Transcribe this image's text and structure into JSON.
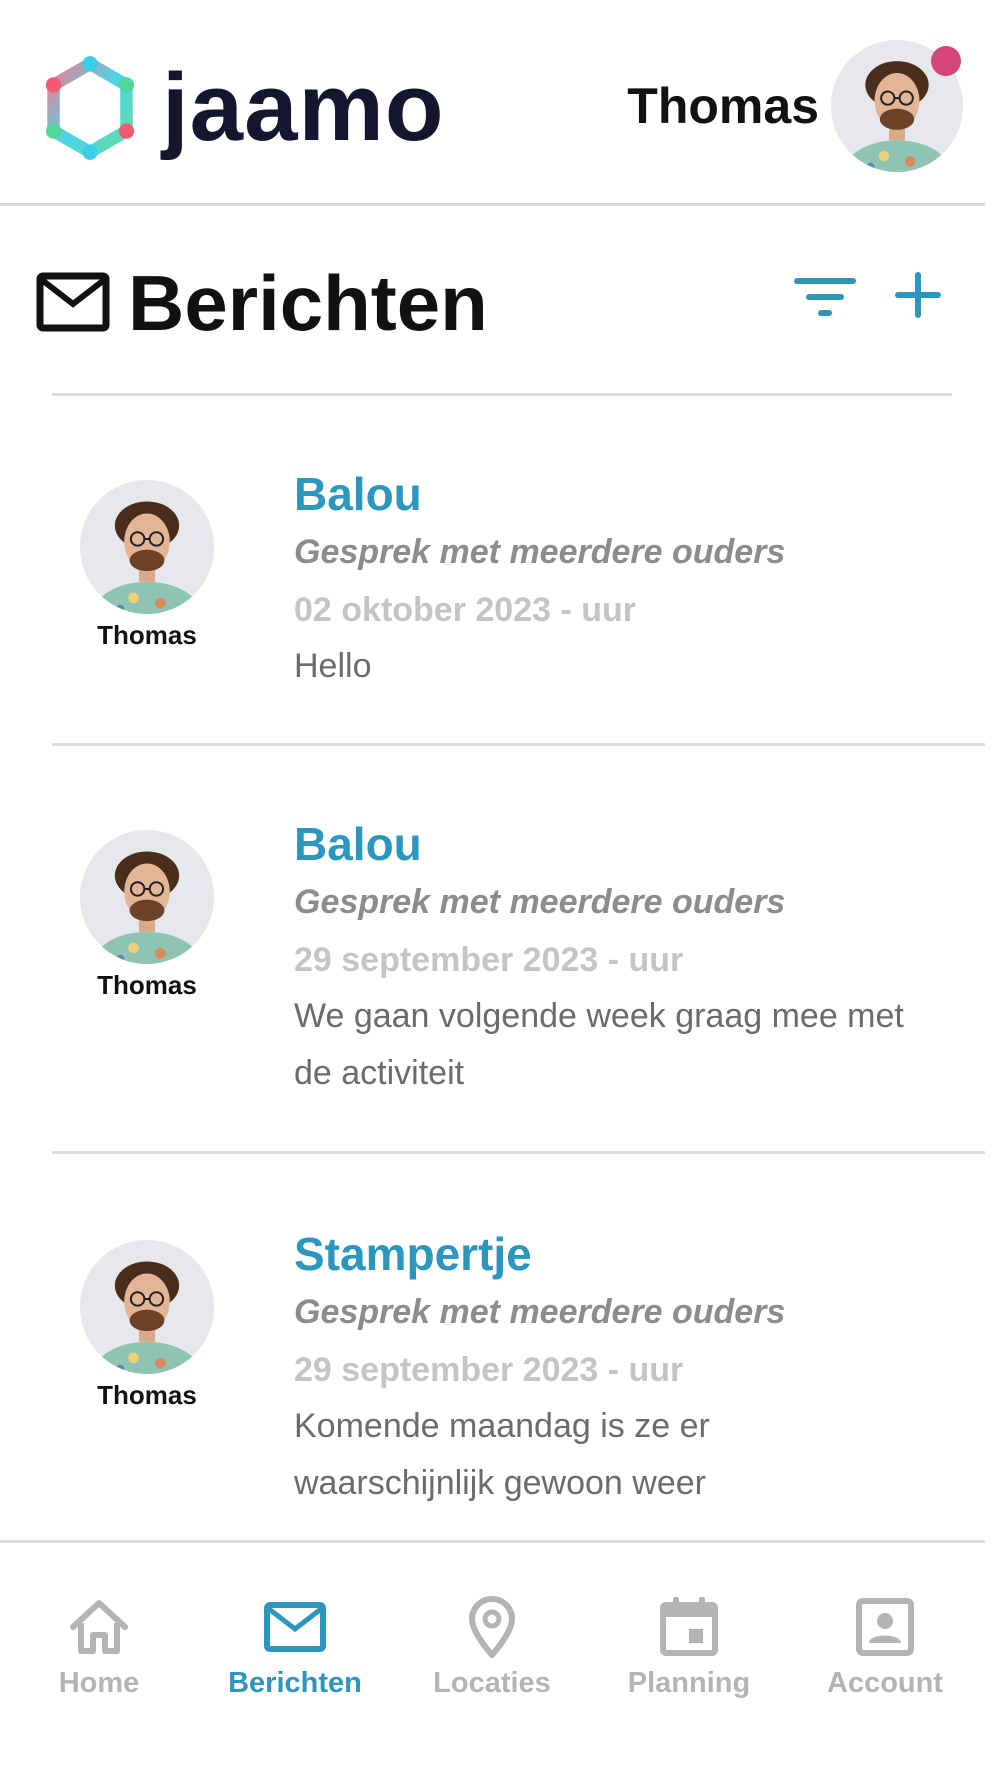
{
  "app": {
    "logo_text": "jaamo",
    "user_name": "Thomas",
    "notification_color": "#d6457a"
  },
  "page": {
    "title": "Berichten",
    "title_icon": "mail-icon",
    "filter_icon": "filter-icon",
    "add_icon": "plus-icon"
  },
  "colors": {
    "accent": "#2c96bf",
    "text_dark": "#111111",
    "muted": "#8c8c8c",
    "inactive_nav": "#b4b4b4"
  },
  "messages": [
    {
      "sender_name": "Thomas",
      "title": "Balou",
      "subtitle": "Gesprek met meerdere ouders",
      "date": "02 oktober 2023 - uur",
      "body": "Hello"
    },
    {
      "sender_name": "Thomas",
      "title": "Balou",
      "subtitle": "Gesprek met meerdere ouders",
      "date": "29 september 2023 - uur",
      "body": "We gaan volgende week graag mee met de activiteit"
    },
    {
      "sender_name": "Thomas",
      "title": "Stampertje",
      "subtitle": "Gesprek met meerdere ouders",
      "date": "29 september 2023 - uur",
      "body": "Komende maandag is ze er waarschijnlijk gewoon weer"
    }
  ],
  "nav": [
    {
      "label": "Home",
      "icon": "home-icon",
      "active": false
    },
    {
      "label": "Berichten",
      "icon": "mail-icon",
      "active": true
    },
    {
      "label": "Locaties",
      "icon": "location-pin-icon",
      "active": false
    },
    {
      "label": "Planning",
      "icon": "calendar-icon",
      "active": false
    },
    {
      "label": "Account",
      "icon": "account-icon",
      "active": false
    }
  ]
}
